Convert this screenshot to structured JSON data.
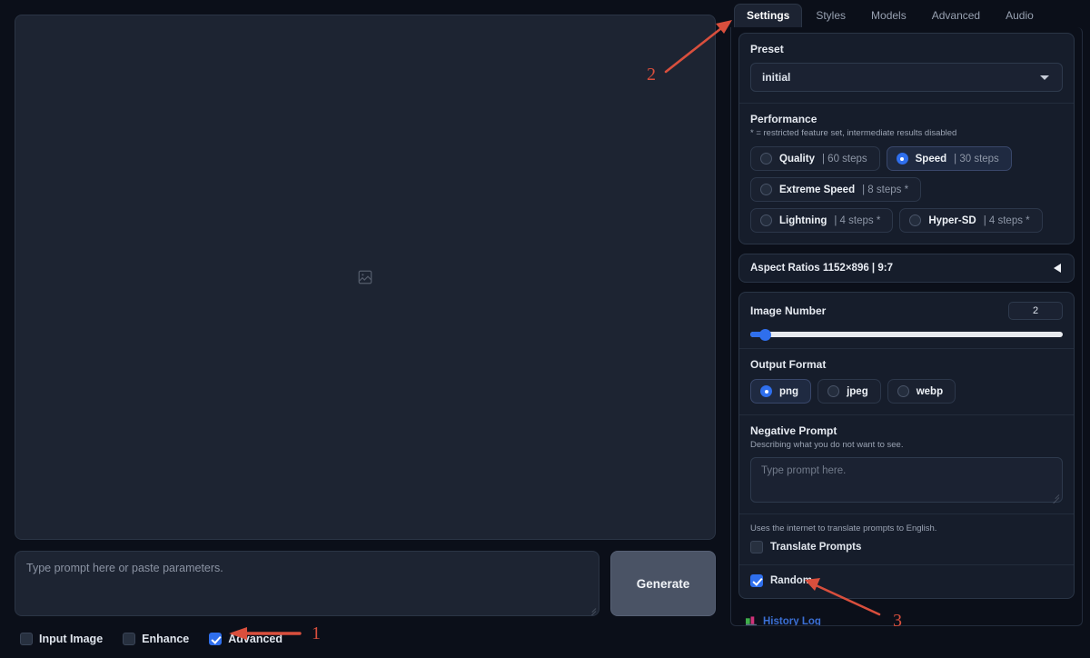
{
  "canvas": {
    "placeholder_icon": "image-placeholder-icon"
  },
  "prompt": {
    "placeholder": "Type prompt here or paste parameters.",
    "value": "",
    "generate_label": "Generate"
  },
  "bottom_checkboxes": [
    {
      "label": "Input Image",
      "checked": false
    },
    {
      "label": "Enhance",
      "checked": false
    },
    {
      "label": "Advanced",
      "checked": true
    }
  ],
  "tabs": [
    {
      "label": "Settings",
      "active": true
    },
    {
      "label": "Styles",
      "active": false
    },
    {
      "label": "Models",
      "active": false
    },
    {
      "label": "Advanced",
      "active": false
    },
    {
      "label": "Audio",
      "active": false
    }
  ],
  "preset": {
    "title": "Preset",
    "selected": "initial",
    "caret_icon": "chevron-down-icon"
  },
  "performance": {
    "title": "Performance",
    "note": "* = restricted feature set, intermediate results disabled",
    "options": [
      {
        "name": "Quality",
        "meta": "| 60 steps",
        "selected": false
      },
      {
        "name": "Speed",
        "meta": "| 30 steps",
        "selected": true
      },
      {
        "name": "Extreme Speed",
        "meta": "| 8 steps *",
        "selected": false
      },
      {
        "name": "Lightning",
        "meta": "| 4 steps *",
        "selected": false
      },
      {
        "name": "Hyper-SD",
        "meta": "| 4 steps *",
        "selected": false
      }
    ]
  },
  "aspect_ratios": {
    "title": "Aspect Ratios 1152×896 | 9:7",
    "collapsed": true,
    "toggle_icon": "triangle-left-icon"
  },
  "image_number": {
    "title": "Image Number",
    "value": "2",
    "slider_percent": 4.5
  },
  "output_format": {
    "title": "Output Format",
    "options": [
      {
        "label": "png",
        "selected": true
      },
      {
        "label": "jpeg",
        "selected": false
      },
      {
        "label": "webp",
        "selected": false
      }
    ]
  },
  "negative_prompt": {
    "title": "Negative Prompt",
    "subtitle": "Describing what you do not want to see.",
    "placeholder": "Type prompt here.",
    "value": ""
  },
  "translate": {
    "hint": "Uses the internet to translate prompts to English.",
    "label": "Translate Prompts",
    "checked": false
  },
  "random": {
    "label": "Random",
    "checked": true
  },
  "history": {
    "label": "History Log",
    "icon": "chart-history-icon"
  },
  "annotations": [
    {
      "number": "1",
      "color": "#d94f3d"
    },
    {
      "number": "2",
      "color": "#d94f3d"
    },
    {
      "number": "3",
      "color": "#d94f3d"
    }
  ],
  "colors": {
    "background": "#0b0f19",
    "panel": "#161d2b",
    "accent_blue": "#2f6fed",
    "link_blue": "#3b6fd4",
    "annotation_red": "#d94f3d",
    "generate_button": "#4a5365"
  }
}
